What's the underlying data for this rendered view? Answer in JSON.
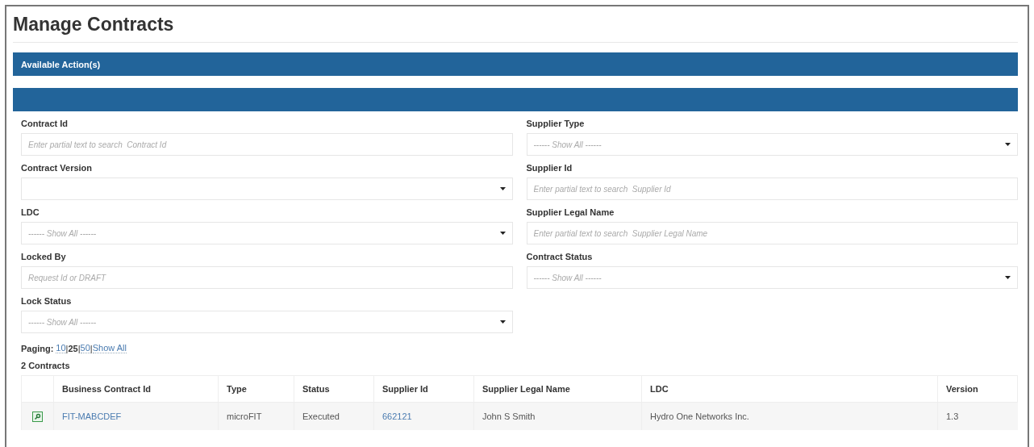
{
  "page": {
    "title": "Manage Contracts"
  },
  "actions_bar": {
    "title": "Available Action(s)"
  },
  "filters": [
    {
      "label": "Contract Id",
      "kind": "text",
      "placeholder": "Enter partial text to search  Contract Id"
    },
    {
      "label": "Supplier Type",
      "kind": "select",
      "value": "------ Show All ------"
    },
    {
      "label": "Contract Version",
      "kind": "select"
    },
    {
      "label": "Supplier Id",
      "kind": "text",
      "placeholder": "Enter partial text to search  Supplier Id"
    },
    {
      "label": "LDC",
      "kind": "select",
      "value": "------ Show All ------"
    },
    {
      "label": "Supplier Legal Name",
      "kind": "text",
      "placeholder": "Enter partial text to search  Supplier Legal Name"
    },
    {
      "label": "Locked By",
      "kind": "text",
      "placeholder": "Request Id or DRAFT"
    },
    {
      "label": "Contract Status",
      "kind": "select",
      "value": "------ Show All ------"
    },
    {
      "label": "Lock Status",
      "kind": "select",
      "value": "------ Show All ------"
    }
  ],
  "paging": {
    "label": "Paging:",
    "separator": "|",
    "options": [
      {
        "label": "10",
        "selected": false
      },
      {
        "label": "25",
        "selected": true
      },
      {
        "label": "50",
        "selected": false
      },
      {
        "label": "Show All",
        "selected": false
      }
    ]
  },
  "table": {
    "count": "2 Contracts",
    "columns": [
      "Business Contract Id",
      "Type",
      "Status",
      "Supplier Id",
      "Supplier Legal Name",
      "LDC",
      "Version"
    ],
    "rows": [
      {
        "cells": [
          "FIT-MABCDEF",
          "microFIT",
          "Executed",
          "662121",
          "John S Smith",
          "Hydro One Networks Inc.",
          "1.3"
        ],
        "links": [
          true,
          false,
          false,
          true,
          false,
          false,
          false
        ]
      }
    ]
  }
}
